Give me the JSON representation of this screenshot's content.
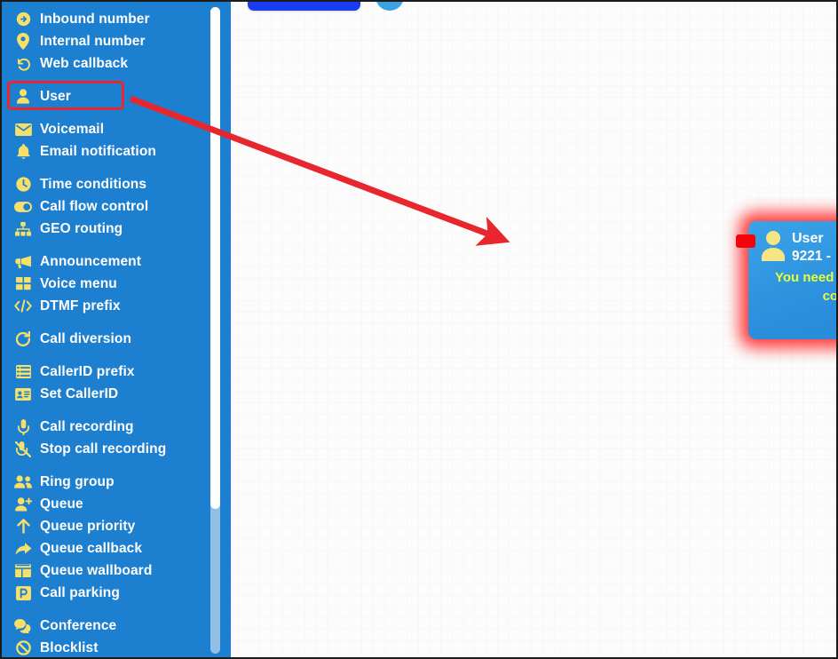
{
  "sidebar": {
    "background_color": "#1d7fd0",
    "icon_color": "#f7e06a",
    "label_color": "#ffffff",
    "items": [
      {
        "label": "Inbound number",
        "icon": "arrow-circle-right-icon",
        "group_start": false
      },
      {
        "label": "Internal number",
        "icon": "map-pin-icon",
        "group_start": false
      },
      {
        "label": "Web callback",
        "icon": "undo-arrow-icon",
        "group_start": false
      },
      {
        "label": "User",
        "icon": "user-icon",
        "group_start": true
      },
      {
        "label": "Voicemail",
        "icon": "envelope-icon",
        "group_start": true
      },
      {
        "label": "Email notification",
        "icon": "bell-icon",
        "group_start": false
      },
      {
        "label": "Time conditions",
        "icon": "clock-icon",
        "group_start": true
      },
      {
        "label": "Call flow control",
        "icon": "toggle-icon",
        "group_start": false
      },
      {
        "label": "GEO routing",
        "icon": "sitemap-icon",
        "group_start": false
      },
      {
        "label": "Announcement",
        "icon": "megaphone-icon",
        "group_start": true
      },
      {
        "label": "Voice menu",
        "icon": "grid-squares-icon",
        "group_start": false
      },
      {
        "label": "DTMF prefix",
        "icon": "code-brackets-icon",
        "group_start": false
      },
      {
        "label": "Call diversion",
        "icon": "refresh-arrow-icon",
        "group_start": true
      },
      {
        "label": "CallerID prefix",
        "icon": "list-lines-icon",
        "group_start": true
      },
      {
        "label": "Set CallerID",
        "icon": "id-card-icon",
        "group_start": false
      },
      {
        "label": "Call recording",
        "icon": "microphone-icon",
        "group_start": true
      },
      {
        "label": "Stop call recording",
        "icon": "microphone-slash-icon",
        "group_start": false
      },
      {
        "label": "Ring group",
        "icon": "users-icon",
        "group_start": true
      },
      {
        "label": "Queue",
        "icon": "user-plus-icon",
        "group_start": false
      },
      {
        "label": "Queue priority",
        "icon": "arrow-up-icon",
        "group_start": false
      },
      {
        "label": "Queue callback",
        "icon": "arrow-share-icon",
        "group_start": false
      },
      {
        "label": "Queue wallboard",
        "icon": "table-icon",
        "group_start": false
      },
      {
        "label": "Call parking",
        "icon": "parking-icon",
        "group_start": false
      },
      {
        "label": "Conference",
        "icon": "comments-icon",
        "group_start": true
      },
      {
        "label": "Blocklist",
        "icon": "ban-circle-icon",
        "group_start": false
      }
    ],
    "selected_item": "User",
    "scrollbar": {
      "track_color": "#93bfe7",
      "thumb_color": "#ffffff"
    }
  },
  "canvas": {
    "background_color": "#fcfcfc",
    "grid_color": "#f0f0f0",
    "top_chips": [
      {
        "name": "blue-rect-chip",
        "color": "#1a3df0"
      },
      {
        "name": "blue-circle-chip",
        "color": "#3fa0e0"
      }
    ]
  },
  "node": {
    "title": "User",
    "extension": "9221 -",
    "warning": "You need to configure this component",
    "title_color": "#ffffff",
    "warning_color": "#e8ff32",
    "body_color": "#2b8fdd",
    "glow_color": "#ff2a2a",
    "port_color": "#f4030b",
    "close_icon": "close-circle-icon",
    "gear_icon": "gear-icon",
    "avatar_icon": "user-avatar-icon"
  },
  "annotation": {
    "arrow_color": "#e8262d",
    "highlight_box_color": "#e8262d",
    "highlight_target": "User"
  }
}
